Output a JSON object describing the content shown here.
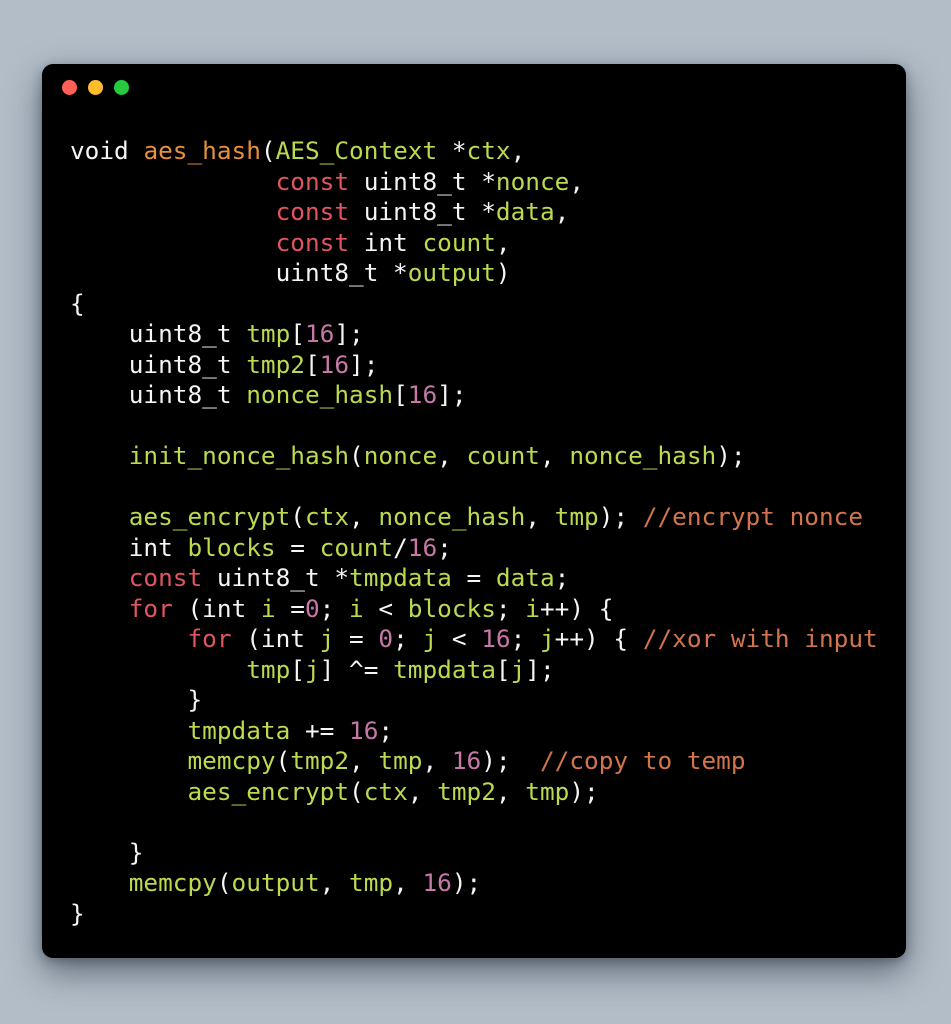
{
  "window": {
    "traffic_lights": [
      {
        "name": "close",
        "color": "#ff5f56"
      },
      {
        "name": "minimize",
        "color": "#ffbd2e"
      },
      {
        "name": "zoom",
        "color": "#27c93f"
      }
    ],
    "background_color": "#000000",
    "page_background_color": "#b2bdc8"
  },
  "theme": {
    "plain": "#f5f5f5",
    "keyword": "#e05561",
    "function_name": "#e8913a",
    "identifier": "#bada4f",
    "number": "#c678a8",
    "comment": "#d2754e"
  },
  "code": {
    "language": "c",
    "plain_text": "void aes_hash(AES_Context *ctx,\n              const uint8_t *nonce,\n              const uint8_t *data,\n              const int count,\n              uint8_t *output)\n{\n    uint8_t tmp[16];\n    uint8_t tmp2[16];\n    uint8_t nonce_hash[16];\n\n    init_nonce_hash(nonce, count, nonce_hash);\n\n    aes_encrypt(ctx, nonce_hash, tmp); //encrypt nonce\n    int blocks = count/16;\n    const uint8_t *tmpdata = data;\n    for (int i =0; i < blocks; i++) {\n        for (int j = 0; j < 16; j++) { //xor with input\n            tmp[j] ^= tmpdata[j];\n        }\n        tmpdata += 16;\n        memcpy(tmp2, tmp, 16);  //copy to temp\n        aes_encrypt(ctx, tmp2, tmp);\n\n    }\n    memcpy(output, tmp, 16);\n}",
    "lines": [
      {
        "n": 1,
        "tokens": [
          {
            "t": "void",
            "c": "plain"
          },
          {
            "t": " ",
            "c": "plain"
          },
          {
            "t": "aes_hash",
            "c": "fn"
          },
          {
            "t": "(",
            "c": "plain"
          },
          {
            "t": "AES_Context",
            "c": "ident"
          },
          {
            "t": " *",
            "c": "plain"
          },
          {
            "t": "ctx",
            "c": "ident"
          },
          {
            "t": ",",
            "c": "plain"
          }
        ]
      },
      {
        "n": 2,
        "tokens": [
          {
            "t": "              ",
            "c": "plain"
          },
          {
            "t": "const",
            "c": "kw"
          },
          {
            "t": " uint8_t *",
            "c": "plain"
          },
          {
            "t": "nonce",
            "c": "ident"
          },
          {
            "t": ",",
            "c": "plain"
          }
        ]
      },
      {
        "n": 3,
        "tokens": [
          {
            "t": "              ",
            "c": "plain"
          },
          {
            "t": "const",
            "c": "kw"
          },
          {
            "t": " uint8_t *",
            "c": "plain"
          },
          {
            "t": "data",
            "c": "ident"
          },
          {
            "t": ",",
            "c": "plain"
          }
        ]
      },
      {
        "n": 4,
        "tokens": [
          {
            "t": "              ",
            "c": "plain"
          },
          {
            "t": "const",
            "c": "kw"
          },
          {
            "t": " int ",
            "c": "plain"
          },
          {
            "t": "count",
            "c": "ident"
          },
          {
            "t": ",",
            "c": "plain"
          }
        ]
      },
      {
        "n": 5,
        "tokens": [
          {
            "t": "              uint8_t *",
            "c": "plain"
          },
          {
            "t": "output",
            "c": "ident"
          },
          {
            "t": ")",
            "c": "plain"
          }
        ]
      },
      {
        "n": 6,
        "tokens": [
          {
            "t": "{",
            "c": "brace"
          }
        ]
      },
      {
        "n": 7,
        "tokens": [
          {
            "t": "    uint8_t ",
            "c": "plain"
          },
          {
            "t": "tmp",
            "c": "ident"
          },
          {
            "t": "[",
            "c": "plain"
          },
          {
            "t": "16",
            "c": "num"
          },
          {
            "t": "];",
            "c": "plain"
          }
        ]
      },
      {
        "n": 8,
        "tokens": [
          {
            "t": "    uint8_t ",
            "c": "plain"
          },
          {
            "t": "tmp2",
            "c": "ident"
          },
          {
            "t": "[",
            "c": "plain"
          },
          {
            "t": "16",
            "c": "num"
          },
          {
            "t": "];",
            "c": "plain"
          }
        ]
      },
      {
        "n": 9,
        "tokens": [
          {
            "t": "    uint8_t ",
            "c": "plain"
          },
          {
            "t": "nonce_hash",
            "c": "ident"
          },
          {
            "t": "[",
            "c": "plain"
          },
          {
            "t": "16",
            "c": "num"
          },
          {
            "t": "];",
            "c": "plain"
          }
        ]
      },
      {
        "n": 10,
        "tokens": [
          {
            "t": "",
            "c": "plain"
          }
        ]
      },
      {
        "n": 11,
        "tokens": [
          {
            "t": "    ",
            "c": "plain"
          },
          {
            "t": "init_nonce_hash",
            "c": "ident"
          },
          {
            "t": "(",
            "c": "plain"
          },
          {
            "t": "nonce",
            "c": "ident"
          },
          {
            "t": ", ",
            "c": "plain"
          },
          {
            "t": "count",
            "c": "ident"
          },
          {
            "t": ", ",
            "c": "plain"
          },
          {
            "t": "nonce_hash",
            "c": "ident"
          },
          {
            "t": ");",
            "c": "plain"
          }
        ]
      },
      {
        "n": 12,
        "tokens": [
          {
            "t": "",
            "c": "plain"
          }
        ]
      },
      {
        "n": 13,
        "tokens": [
          {
            "t": "    ",
            "c": "plain"
          },
          {
            "t": "aes_encrypt",
            "c": "ident"
          },
          {
            "t": "(",
            "c": "plain"
          },
          {
            "t": "ctx",
            "c": "ident"
          },
          {
            "t": ", ",
            "c": "plain"
          },
          {
            "t": "nonce_hash",
            "c": "ident"
          },
          {
            "t": ", ",
            "c": "plain"
          },
          {
            "t": "tmp",
            "c": "ident"
          },
          {
            "t": "); ",
            "c": "plain"
          },
          {
            "t": "//encrypt nonce",
            "c": "comment"
          }
        ]
      },
      {
        "n": 14,
        "tokens": [
          {
            "t": "    int ",
            "c": "plain"
          },
          {
            "t": "blocks",
            "c": "ident"
          },
          {
            "t": " = ",
            "c": "plain"
          },
          {
            "t": "count",
            "c": "ident"
          },
          {
            "t": "/",
            "c": "plain"
          },
          {
            "t": "16",
            "c": "num"
          },
          {
            "t": ";",
            "c": "plain"
          }
        ]
      },
      {
        "n": 15,
        "tokens": [
          {
            "t": "    ",
            "c": "plain"
          },
          {
            "t": "const",
            "c": "kw"
          },
          {
            "t": " uint8_t *",
            "c": "plain"
          },
          {
            "t": "tmpdata",
            "c": "ident"
          },
          {
            "t": " = ",
            "c": "plain"
          },
          {
            "t": "data",
            "c": "ident"
          },
          {
            "t": ";",
            "c": "plain"
          }
        ]
      },
      {
        "n": 16,
        "tokens": [
          {
            "t": "    ",
            "c": "plain"
          },
          {
            "t": "for",
            "c": "kw"
          },
          {
            "t": " (int ",
            "c": "plain"
          },
          {
            "t": "i",
            "c": "ident"
          },
          {
            "t": " =",
            "c": "plain"
          },
          {
            "t": "0",
            "c": "num"
          },
          {
            "t": "; ",
            "c": "plain"
          },
          {
            "t": "i",
            "c": "ident"
          },
          {
            "t": " < ",
            "c": "plain"
          },
          {
            "t": "blocks",
            "c": "ident"
          },
          {
            "t": "; ",
            "c": "plain"
          },
          {
            "t": "i",
            "c": "ident"
          },
          {
            "t": "++) {",
            "c": "plain"
          }
        ]
      },
      {
        "n": 17,
        "tokens": [
          {
            "t": "        ",
            "c": "plain"
          },
          {
            "t": "for",
            "c": "kw"
          },
          {
            "t": " (int ",
            "c": "plain"
          },
          {
            "t": "j",
            "c": "ident"
          },
          {
            "t": " = ",
            "c": "plain"
          },
          {
            "t": "0",
            "c": "num"
          },
          {
            "t": "; ",
            "c": "plain"
          },
          {
            "t": "j",
            "c": "ident"
          },
          {
            "t": " < ",
            "c": "plain"
          },
          {
            "t": "16",
            "c": "num"
          },
          {
            "t": "; ",
            "c": "plain"
          },
          {
            "t": "j",
            "c": "ident"
          },
          {
            "t": "++) { ",
            "c": "plain"
          },
          {
            "t": "//xor with input",
            "c": "comment"
          }
        ]
      },
      {
        "n": 18,
        "tokens": [
          {
            "t": "            ",
            "c": "plain"
          },
          {
            "t": "tmp",
            "c": "ident"
          },
          {
            "t": "[",
            "c": "plain"
          },
          {
            "t": "j",
            "c": "ident"
          },
          {
            "t": "] ^= ",
            "c": "plain"
          },
          {
            "t": "tmpdata",
            "c": "ident"
          },
          {
            "t": "[",
            "c": "plain"
          },
          {
            "t": "j",
            "c": "ident"
          },
          {
            "t": "];",
            "c": "plain"
          }
        ]
      },
      {
        "n": 19,
        "tokens": [
          {
            "t": "        }",
            "c": "brace"
          }
        ]
      },
      {
        "n": 20,
        "tokens": [
          {
            "t": "        ",
            "c": "plain"
          },
          {
            "t": "tmpdata",
            "c": "ident"
          },
          {
            "t": " += ",
            "c": "plain"
          },
          {
            "t": "16",
            "c": "num"
          },
          {
            "t": ";",
            "c": "plain"
          }
        ]
      },
      {
        "n": 21,
        "tokens": [
          {
            "t": "        ",
            "c": "plain"
          },
          {
            "t": "memcpy",
            "c": "ident"
          },
          {
            "t": "(",
            "c": "plain"
          },
          {
            "t": "tmp2",
            "c": "ident"
          },
          {
            "t": ", ",
            "c": "plain"
          },
          {
            "t": "tmp",
            "c": "ident"
          },
          {
            "t": ", ",
            "c": "plain"
          },
          {
            "t": "16",
            "c": "num"
          },
          {
            "t": ");  ",
            "c": "plain"
          },
          {
            "t": "//copy to temp",
            "c": "comment"
          }
        ]
      },
      {
        "n": 22,
        "tokens": [
          {
            "t": "        ",
            "c": "plain"
          },
          {
            "t": "aes_encrypt",
            "c": "ident"
          },
          {
            "t": "(",
            "c": "plain"
          },
          {
            "t": "ctx",
            "c": "ident"
          },
          {
            "t": ", ",
            "c": "plain"
          },
          {
            "t": "tmp2",
            "c": "ident"
          },
          {
            "t": ", ",
            "c": "plain"
          },
          {
            "t": "tmp",
            "c": "ident"
          },
          {
            "t": ");",
            "c": "plain"
          }
        ]
      },
      {
        "n": 23,
        "tokens": [
          {
            "t": "",
            "c": "plain"
          }
        ]
      },
      {
        "n": 24,
        "tokens": [
          {
            "t": "    }",
            "c": "brace"
          }
        ]
      },
      {
        "n": 25,
        "tokens": [
          {
            "t": "    ",
            "c": "plain"
          },
          {
            "t": "memcpy",
            "c": "ident"
          },
          {
            "t": "(",
            "c": "plain"
          },
          {
            "t": "output",
            "c": "ident"
          },
          {
            "t": ", ",
            "c": "plain"
          },
          {
            "t": "tmp",
            "c": "ident"
          },
          {
            "t": ", ",
            "c": "plain"
          },
          {
            "t": "16",
            "c": "num"
          },
          {
            "t": ");",
            "c": "plain"
          }
        ]
      },
      {
        "n": 26,
        "tokens": [
          {
            "t": "}",
            "c": "brace"
          }
        ]
      }
    ]
  }
}
